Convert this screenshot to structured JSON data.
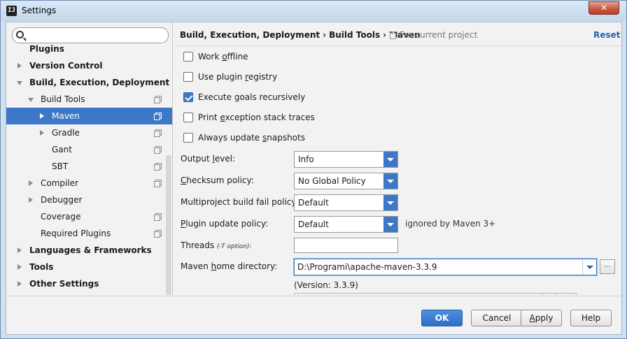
{
  "window": {
    "title": "Settings",
    "app_icon_glyph": "IJ",
    "close_glyph": "✕"
  },
  "sidebar": {
    "search_placeholder": "",
    "items": [
      {
        "label": "Plugins"
      },
      {
        "label": "Version Control"
      },
      {
        "label": "Build, Execution, Deployment"
      },
      {
        "label": "Build Tools"
      },
      {
        "label": "Maven"
      },
      {
        "label": "Gradle"
      },
      {
        "label": "Gant"
      },
      {
        "label": "SBT"
      },
      {
        "label": "Compiler"
      },
      {
        "label": "Debugger"
      },
      {
        "label": "Coverage"
      },
      {
        "label": "Required Plugins"
      },
      {
        "label": "Languages & Frameworks"
      },
      {
        "label": "Tools"
      },
      {
        "label": "Other Settings"
      }
    ]
  },
  "header": {
    "crumb1": "Build, Execution, Deployment",
    "crumb2": "Build Tools",
    "crumb3": "Maven",
    "separator": "›",
    "scope": "For current project",
    "reset": "Reset"
  },
  "options": {
    "work_offline": {
      "label_pre": "Work ",
      "label_u": "o",
      "label_post": "ffline",
      "checked": false
    },
    "use_plugin_registry": {
      "label_pre": "Use plugin ",
      "label_u": "r",
      "label_post": "egistry",
      "checked": false
    },
    "execute_goals": {
      "label_pre": "Execute ",
      "label_u": "g",
      "label_post": "oals recursively",
      "checked": true
    },
    "print_exception": {
      "label_pre": "Print ",
      "label_u": "e",
      "label_post": "xception stack traces",
      "checked": false
    },
    "always_update": {
      "label_pre": "Always update ",
      "label_u": "s",
      "label_post": "napshots",
      "checked": false
    }
  },
  "fields": {
    "output_level": {
      "label_pre": "Output ",
      "label_u": "l",
      "label_post": "evel:",
      "value": "Info"
    },
    "checksum_policy": {
      "label_pre": "",
      "label_u": "C",
      "label_post": "hecksum policy:",
      "value": "No Global Policy"
    },
    "multiproject_policy": {
      "label": "Multiproject build fail policy:",
      "value": "Default"
    },
    "plugin_update_policy": {
      "label_pre": "",
      "label_u": "P",
      "label_post": "lugin update policy:",
      "value": "Default",
      "note": "ignored by Maven 3+"
    },
    "threads": {
      "label": "Threads",
      "hint": "(-T option):",
      "value": ""
    },
    "maven_home": {
      "label_pre": "Maven ",
      "label_u": "h",
      "label_post": "ome directory:",
      "value": "D:\\Programi\\apache-maven-3.3.9",
      "browse": "...",
      "version": "(Version: 3.3.9)"
    }
  },
  "footer": {
    "ok": "OK",
    "cancel": "Cancel",
    "apply_u": "A",
    "apply_rest": "pply",
    "help": "Help"
  }
}
